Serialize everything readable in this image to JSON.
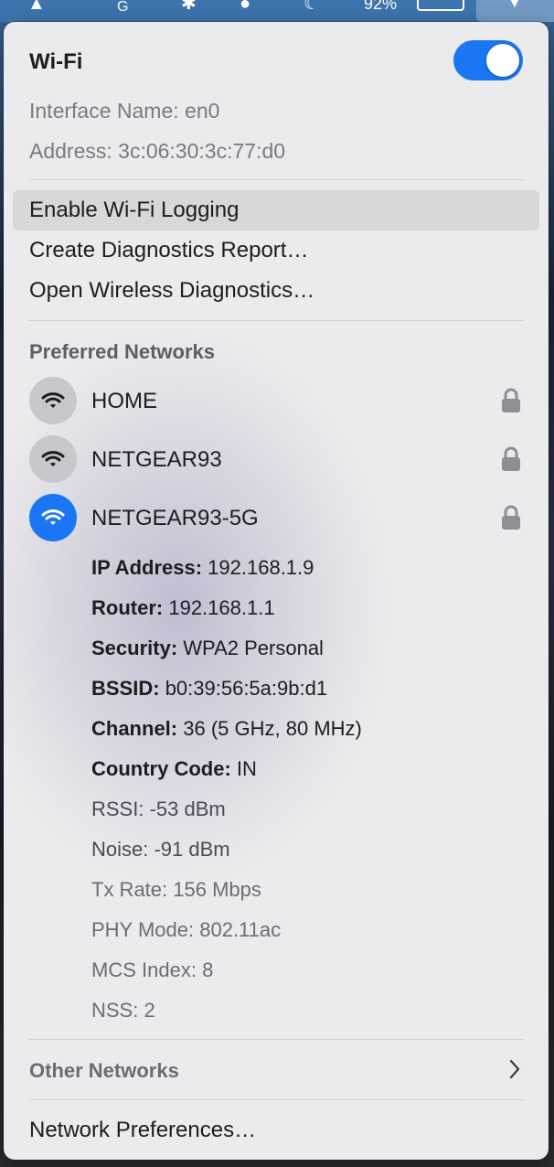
{
  "menubar": {
    "battery_percent": "92%"
  },
  "wifi": {
    "title": "Wi-Fi",
    "enabled": true,
    "interface_label": "Interface Name:",
    "interface_value": "en0",
    "address_label": "Address:",
    "address_value": "3c:06:30:3c:77:d0"
  },
  "menu": {
    "enable_logging": "Enable Wi-Fi Logging",
    "create_report": "Create Diagnostics Report…",
    "open_diagnostics": "Open Wireless Diagnostics…"
  },
  "preferred": {
    "heading": "Preferred Networks",
    "networks": [
      {
        "name": "HOME",
        "secured": true,
        "connected": false
      },
      {
        "name": "NETGEAR93",
        "secured": true,
        "connected": false
      },
      {
        "name": "NETGEAR93-5G",
        "secured": true,
        "connected": true
      }
    ]
  },
  "details": [
    {
      "label": "IP Address:",
      "value": "192.168.1.9"
    },
    {
      "label": "Router:",
      "value": "192.168.1.1"
    },
    {
      "label": "Security:",
      "value": "WPA2 Personal"
    },
    {
      "label": "BSSID:",
      "value": "b0:39:56:5a:9b:d1"
    },
    {
      "label": "Channel:",
      "value": "36 (5 GHz, 80 MHz)"
    },
    {
      "label": "Country Code:",
      "value": "IN"
    },
    {
      "label": "RSSI:",
      "value": "-53 dBm"
    },
    {
      "label": "Noise:",
      "value": "-91 dBm"
    },
    {
      "label": "Tx Rate:",
      "value": "156 Mbps"
    },
    {
      "label": "PHY Mode:",
      "value": "802.11ac"
    },
    {
      "label": "MCS Index:",
      "value": "8"
    },
    {
      "label": "NSS:",
      "value": "2"
    }
  ],
  "other_networks": "Other Networks",
  "network_preferences": "Network Preferences…",
  "colors": {
    "accent": "#1a76f2",
    "panel_bg": "#ebebed"
  }
}
